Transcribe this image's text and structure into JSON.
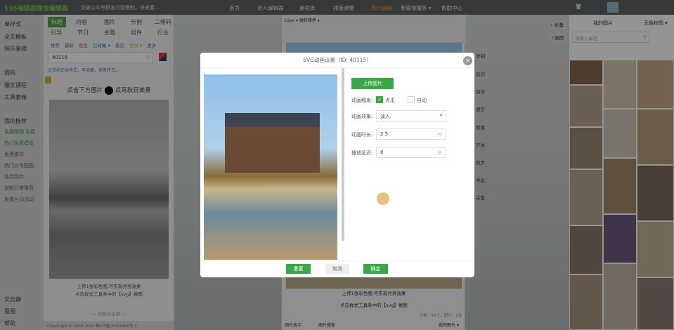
{
  "topbar": {
    "logo": "135编辑器微信编辑器",
    "notice": "突破公众号群发次数限制，快来看...",
    "nav": [
      "首页",
      "进入编辑器",
      "素材库",
      "排版课堂",
      "PDF编辑",
      "新媒体服务 ▾",
      "帮助中心"
    ]
  },
  "leftnav": {
    "items": [
      "单样式",
      "全文模板",
      "快乐暑假",
      "我的",
      "爆文课程",
      "工具套箱"
    ],
    "recommend_title": "我的推荐",
    "recommend": [
      "免费赠图 免费",
      "热门免费模板",
      "免费素材",
      "热门公号配图",
      "免费图库",
      "定制日常推荐",
      "免费互动活动"
    ],
    "bottom": [
      "文云静",
      "看图",
      "帮助"
    ]
  },
  "styles": {
    "tabs_row1": [
      "标题",
      "内容",
      "图片",
      "分割",
      "二维码"
    ],
    "tabs_row2": [
      "引导",
      "节日",
      "主题",
      "组件",
      "行业"
    ],
    "filters": [
      "推荐",
      "最新",
      "签名",
      "已收藏 ▾",
      "最近",
      "会员 ▾",
      "更多"
    ],
    "search_value": "40115",
    "tip": "点击标记本样式，可收藏，查看样式。",
    "preview_heading_left": "点击下方图片",
    "preview_heading_right": "点亮秋日美景",
    "caption1": "上传1张彩色图,可实现点亮效果",
    "caption2": "点击样式工具条中的【svg】换图",
    "loaded_all": "— 已显示全部 —",
    "copyright": "CopyRight © 2016-2022 豫ICP备16024485号-1"
  },
  "editor": {
    "font_size": "16px ▾",
    "font_family": "微软雅黑 ▾",
    "caption1": "上传1张彩色图,可实现点亮效果",
    "caption2": "点击样式工具条中的【svg】换图",
    "status": "字数：40个，图片：1张",
    "bottom_left": [
      "图片找字",
      "图片搜索"
    ],
    "bottom_right": "我的图片 ▾"
  },
  "side_buttons": [
    "复制",
    "剪切",
    "保存",
    "清空",
    "替换",
    "开关",
    "同步",
    "导出",
    "采集"
  ],
  "right_panel": {
    "collapse": "» 折叠",
    "draw": "/ 画图",
    "title": "我的图片",
    "copyright_img": "无版权图 ▾",
    "search_placeholder": "请输入标签"
  },
  "dialog": {
    "title": "SVG动画设置（ID: 40115）",
    "upload_button": "上传图片",
    "trigger_label": "动画触发:",
    "trigger_click": "点击",
    "trigger_auto": "自动",
    "trigger_click_checked": true,
    "trigger_auto_checked": false,
    "effect_label": "动画效果:",
    "effect_value": "淡入",
    "duration_label": "动画时长:",
    "duration_value": "2.5",
    "delay_label": "播放延迟:",
    "delay_value": "0",
    "unit": "秒",
    "reset": "重置",
    "cancel": "取消",
    "confirm": "确定"
  },
  "colors": {
    "accent": "#3aa846",
    "overlay": "rgba(0,0,0,0.42)"
  }
}
